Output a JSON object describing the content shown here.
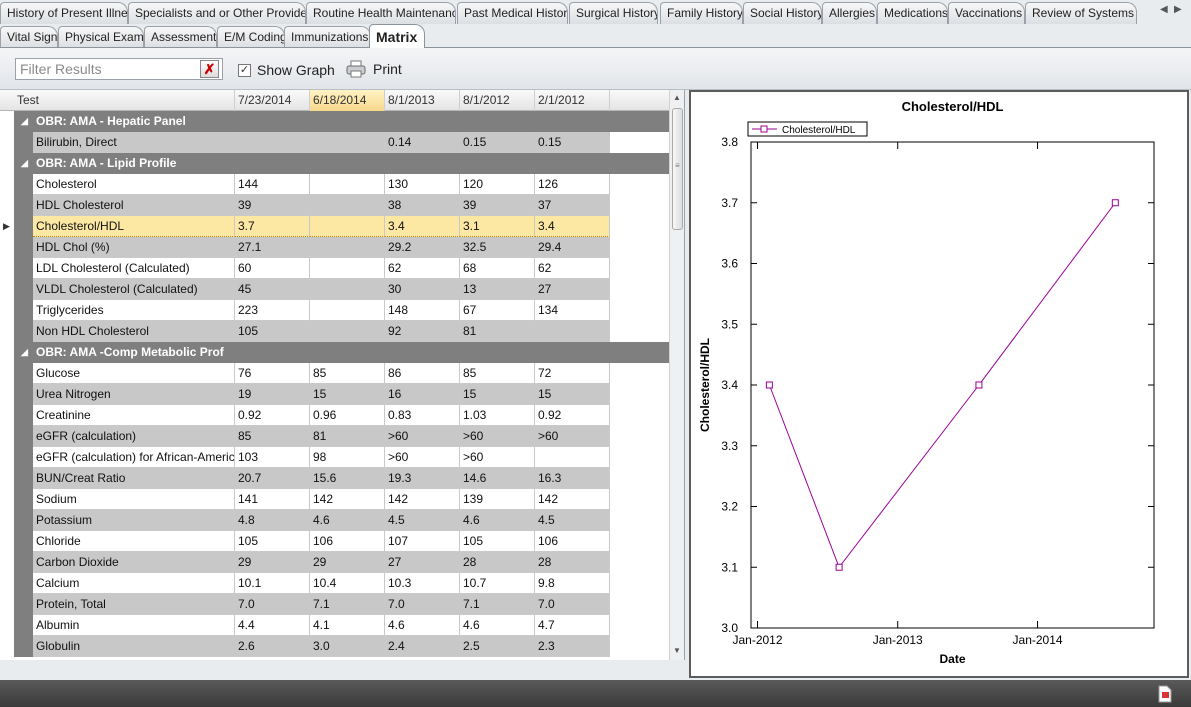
{
  "tabs_row1": [
    "History of Present Illness",
    "Specialists and or Other Providers",
    "Routine Health Maintenance",
    "Past Medical History",
    "Surgical History",
    "Family History",
    "Social History",
    "Allergies",
    "Medications",
    "Vaccinations",
    "Review of Systems"
  ],
  "tabs_row2": [
    "Vital Signs",
    "Physical Exam",
    "Assessment",
    "E/M Coding",
    "Immunizations",
    "Matrix"
  ],
  "active_tab": "Matrix",
  "toolbar": {
    "filter_placeholder": "Filter Results",
    "show_graph_label": "Show Graph",
    "show_graph_checked": true,
    "print_label": "Print"
  },
  "grid": {
    "columns": [
      "Test",
      "7/23/2014",
      "6/18/2014",
      "8/1/2013",
      "8/1/2012",
      "2/1/2012"
    ],
    "sorted_column": "6/18/2014",
    "groups": [
      {
        "name": "OBR: AMA - Hepatic Panel",
        "rows": [
          {
            "test": "Bilirubin, Direct",
            "values": [
              "",
              "",
              "0.14",
              "0.15",
              "0.15"
            ]
          }
        ]
      },
      {
        "name": "OBR: AMA - Lipid Profile",
        "rows": [
          {
            "test": "Cholesterol",
            "values": [
              "144",
              "",
              "130",
              "120",
              "126"
            ]
          },
          {
            "test": "HDL Cholesterol",
            "values": [
              "39",
              "",
              "38",
              "39",
              "37"
            ]
          },
          {
            "test": "Cholesterol/HDL",
            "values": [
              "3.7",
              "",
              "3.4",
              "3.1",
              "3.4"
            ],
            "selected": true
          },
          {
            "test": "HDL Chol (%)",
            "values": [
              "27.1",
              "",
              "29.2",
              "32.5",
              "29.4"
            ]
          },
          {
            "test": "LDL Cholesterol (Calculated)",
            "values": [
              "60",
              "",
              "62",
              "68",
              "62"
            ]
          },
          {
            "test": "VLDL Cholesterol (Calculated)",
            "values": [
              "45",
              "",
              "30",
              "13",
              "27"
            ]
          },
          {
            "test": "Triglycerides",
            "values": [
              "223",
              "",
              "148",
              "67",
              "134"
            ]
          },
          {
            "test": "Non HDL Cholesterol",
            "values": [
              "105",
              "",
              "92",
              "81",
              ""
            ]
          }
        ]
      },
      {
        "name": "OBR: AMA -Comp Metabolic Prof",
        "rows": [
          {
            "test": "Glucose",
            "values": [
              "76",
              "85",
              "86",
              "85",
              "72"
            ]
          },
          {
            "test": "Urea Nitrogen",
            "values": [
              "19",
              "15",
              "16",
              "15",
              "15"
            ]
          },
          {
            "test": "Creatinine",
            "values": [
              "0.92",
              "0.96",
              "0.83",
              "1.03",
              "0.92"
            ]
          },
          {
            "test": "eGFR (calculation)",
            "values": [
              "85",
              "81",
              ">60",
              ">60",
              ">60"
            ]
          },
          {
            "test": "eGFR (calculation) for African-Americans",
            "values": [
              "103",
              "98",
              ">60",
              ">60",
              ""
            ]
          },
          {
            "test": "BUN/Creat Ratio",
            "values": [
              "20.7",
              "15.6",
              "19.3",
              "14.6",
              "16.3"
            ]
          },
          {
            "test": "Sodium",
            "values": [
              "141",
              "142",
              "142",
              "139",
              "142"
            ]
          },
          {
            "test": "Potassium",
            "values": [
              "4.8",
              "4.6",
              "4.5",
              "4.6",
              "4.5"
            ]
          },
          {
            "test": "Chloride",
            "values": [
              "105",
              "106",
              "107",
              "105",
              "106"
            ]
          },
          {
            "test": "Carbon Dioxide",
            "values": [
              "29",
              "29",
              "27",
              "28",
              "28"
            ]
          },
          {
            "test": "Calcium",
            "values": [
              "10.1",
              "10.4",
              "10.3",
              "10.7",
              "9.8"
            ]
          },
          {
            "test": "Protein, Total",
            "values": [
              "7.0",
              "7.1",
              "7.0",
              "7.1",
              "7.0"
            ]
          },
          {
            "test": "Albumin",
            "values": [
              "4.4",
              "4.1",
              "4.6",
              "4.6",
              "4.7"
            ]
          },
          {
            "test": "Globulin",
            "values": [
              "2.6",
              "3.0",
              "2.4",
              "2.5",
              "2.3"
            ]
          }
        ]
      }
    ]
  },
  "chart_data": {
    "type": "line",
    "title": "Cholesterol/HDL",
    "xlabel": "Date",
    "ylabel": "Cholesterol/HDL",
    "legend": "top-left",
    "series": [
      {
        "name": "Cholesterol/HDL",
        "color": "#990099",
        "x": [
          "2012-02-01",
          "2012-08-01",
          "2013-08-01",
          "2014-07-23"
        ],
        "y": [
          3.4,
          3.1,
          3.4,
          3.7
        ]
      }
    ],
    "ylim": [
      3.0,
      3.8
    ],
    "yticks": [
      "3.0",
      "3.1",
      "3.2",
      "3.3",
      "3.4",
      "3.5",
      "3.6",
      "3.7",
      "3.8"
    ],
    "xlim": [
      "2011-12-15",
      "2014-11-01"
    ],
    "xticks": [
      {
        "date": "2012-01-01",
        "label": "Jan-2012"
      },
      {
        "date": "2013-01-01",
        "label": "Jan-2013"
      },
      {
        "date": "2014-01-01",
        "label": "Jan-2014"
      }
    ],
    "grid": false
  },
  "colors": {
    "group_header": "#7f7f7f",
    "alt_row": "#c8c8c8",
    "selected_row": "#fce7a3",
    "series": "#990099",
    "bottom_bar": "#474747"
  }
}
